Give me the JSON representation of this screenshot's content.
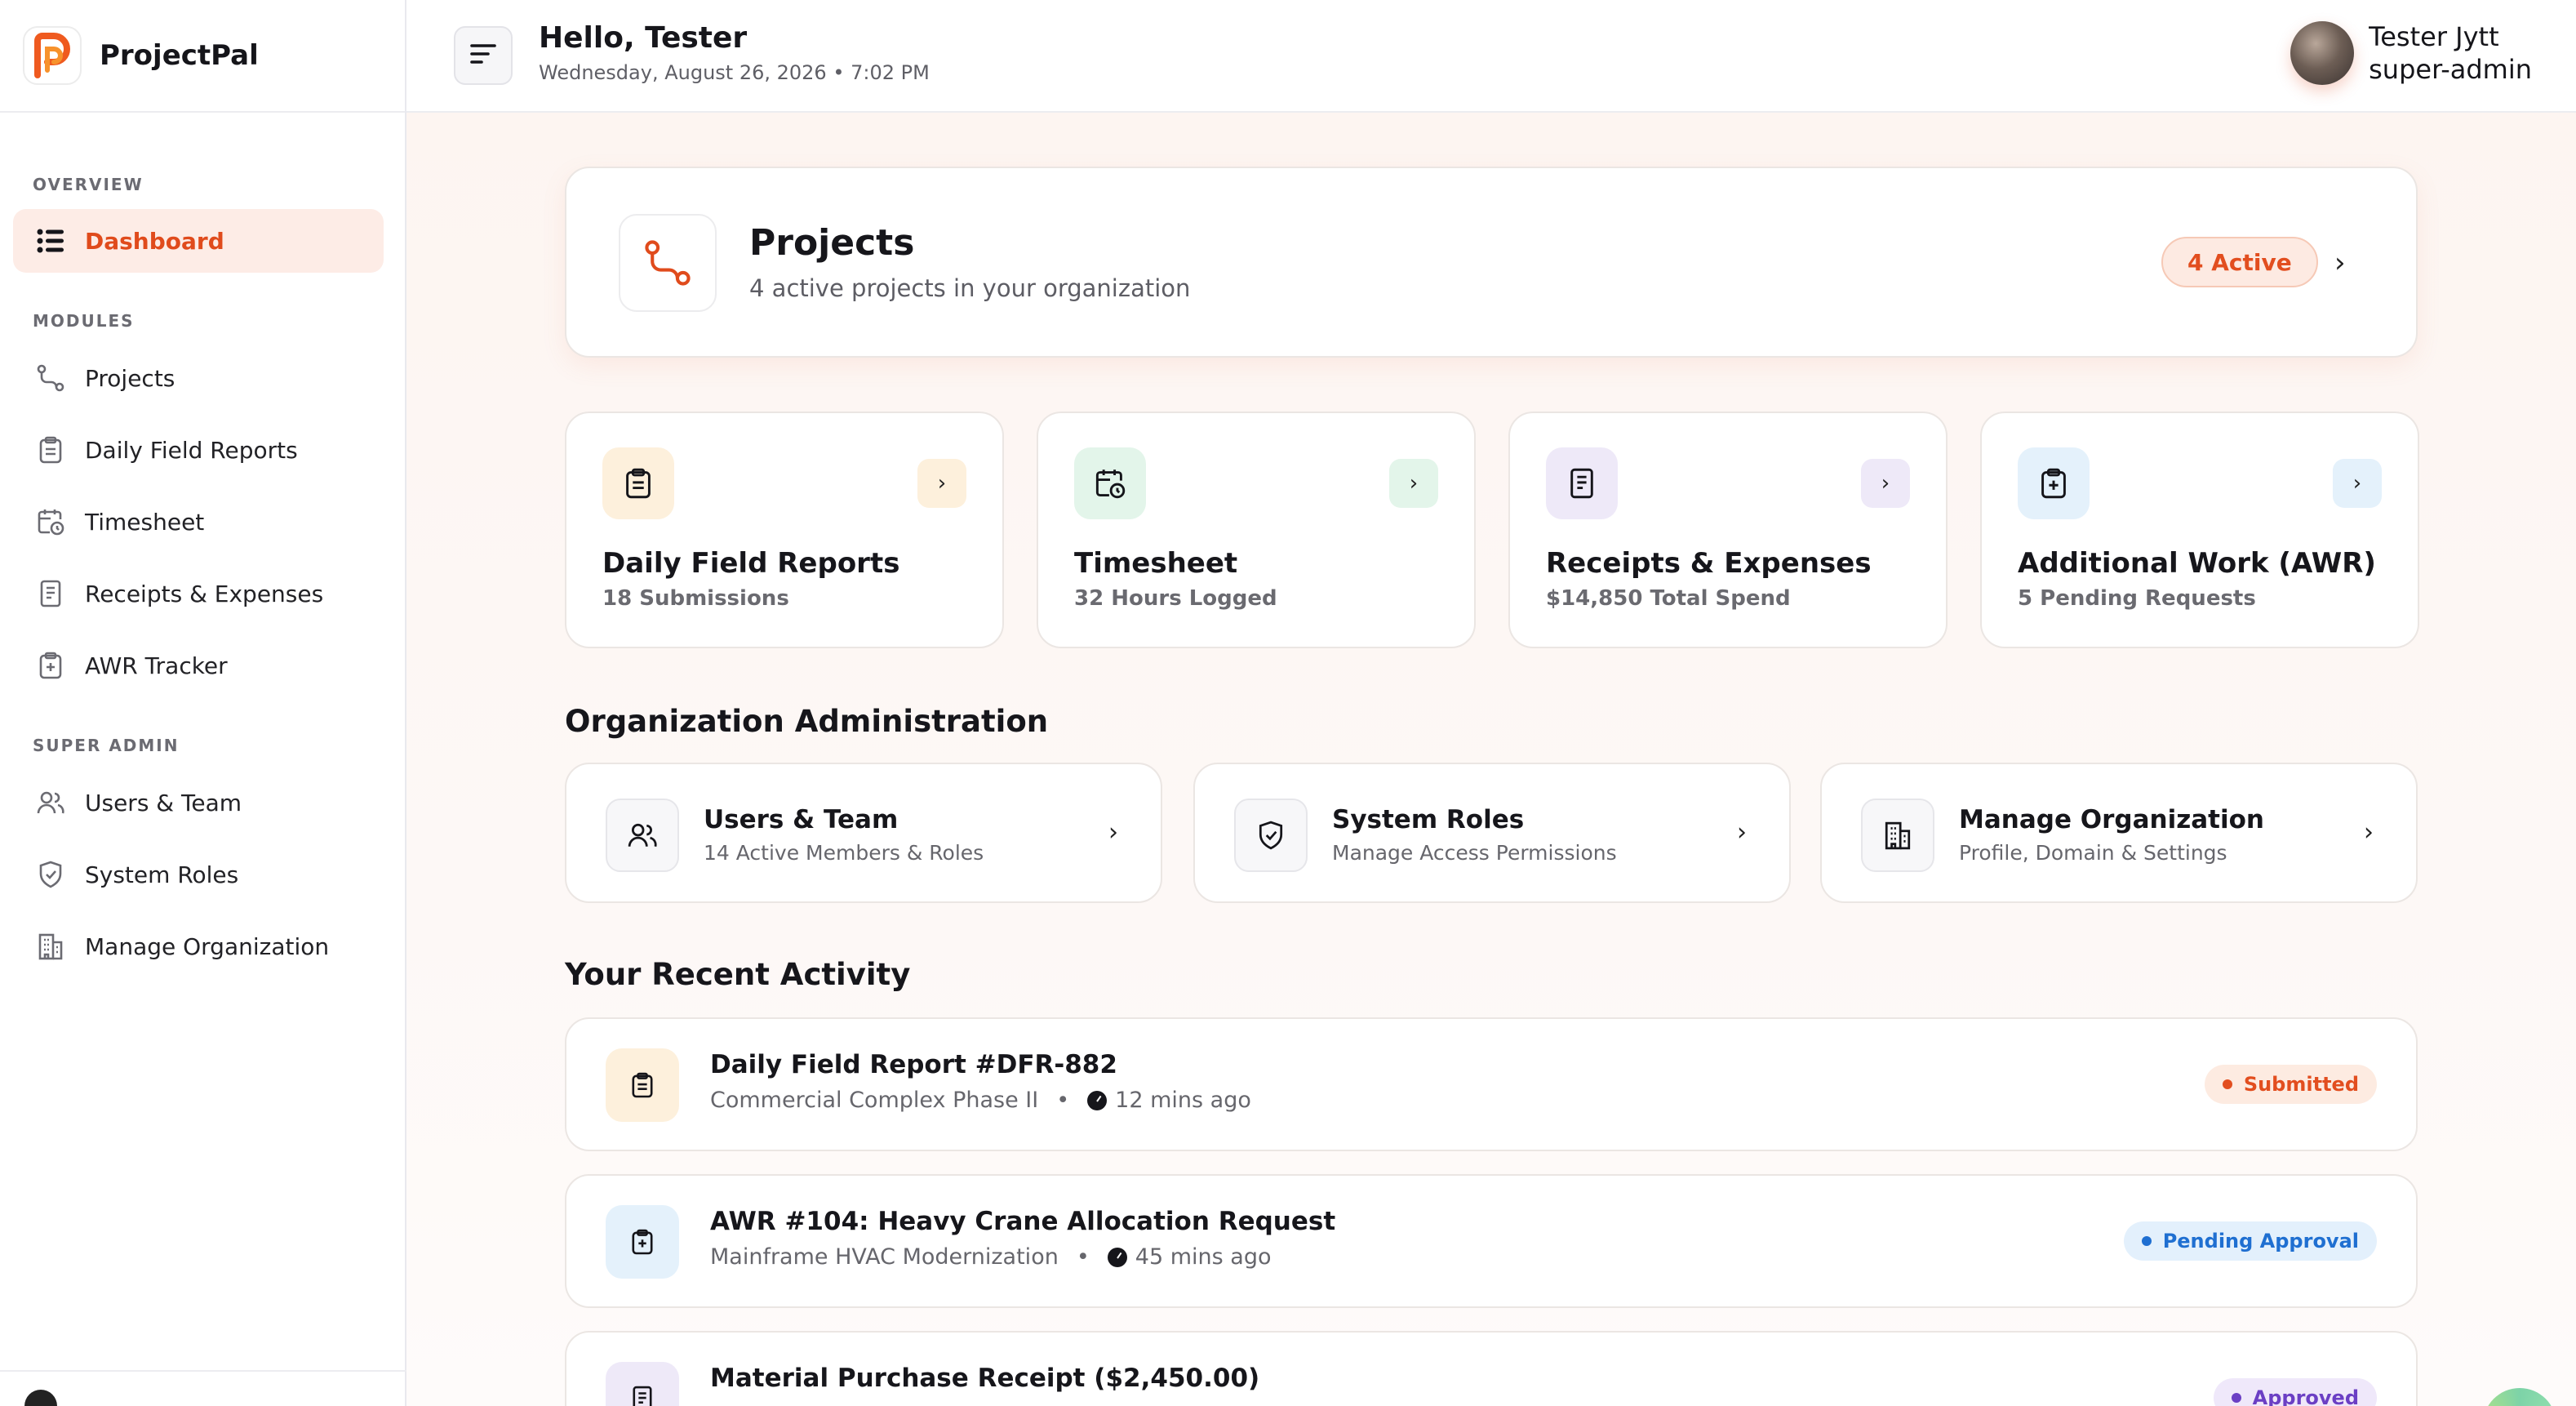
{
  "app": {
    "name": "ProjectPal"
  },
  "header": {
    "greeting": "Hello, Tester",
    "datetime": "Wednesday, August 26, 2026 • 7:02 PM",
    "user_name": "Tester Jytt",
    "user_role": "super-admin"
  },
  "sidebar": {
    "sections": {
      "overview": "OVERVIEW",
      "modules": "MODULES",
      "super_admin": "SUPER ADMIN"
    },
    "items": {
      "dashboard": "Dashboard",
      "projects": "Projects",
      "daily_field_reports": "Daily Field Reports",
      "timesheet": "Timesheet",
      "receipts_expenses": "Receipts & Expenses",
      "awr_tracker": "AWR Tracker",
      "users_team": "Users & Team",
      "system_roles": "System Roles",
      "manage_organization": "Manage Organization"
    }
  },
  "projects_card": {
    "title": "Projects",
    "subtitle": "4 active projects in your organization",
    "badge": "4 Active"
  },
  "modules": {
    "daily_field_reports": {
      "title": "Daily Field Reports",
      "subtitle": "18 Submissions"
    },
    "timesheet": {
      "title": "Timesheet",
      "subtitle": "32 Hours Logged"
    },
    "receipts_expenses": {
      "title": "Receipts & Expenses",
      "subtitle": "$14,850 Total Spend"
    },
    "additional_work": {
      "title": "Additional Work (AWR)",
      "subtitle": "5 Pending Requests"
    }
  },
  "org_admin": {
    "section_title": "Organization Administration",
    "users_team": {
      "title": "Users & Team",
      "subtitle": "14 Active Members & Roles"
    },
    "system_roles": {
      "title": "System Roles",
      "subtitle": "Manage Access Permissions"
    },
    "manage_org": {
      "title": "Manage Organization",
      "subtitle": "Profile, Domain & Settings"
    }
  },
  "activity": {
    "section_title": "Your Recent Activity",
    "items": [
      {
        "title": "Daily Field Report #DFR-882",
        "project": "Commercial Complex Phase II",
        "time": "12 mins ago",
        "status": "Submitted"
      },
      {
        "title": "AWR #104: Heavy Crane Allocation Request",
        "project": "Mainframe HVAC Modernization",
        "time": "45 mins ago",
        "status": "Pending Approval"
      },
      {
        "title": "Material Purchase Receipt ($2,450.00)",
        "project": "",
        "time": "",
        "status": "Approved"
      }
    ]
  },
  "colors": {
    "accent": "#e04b1c",
    "submitted": "#e24e1f",
    "pending": "#1f6fd1",
    "approved": "#6b3fc4"
  }
}
